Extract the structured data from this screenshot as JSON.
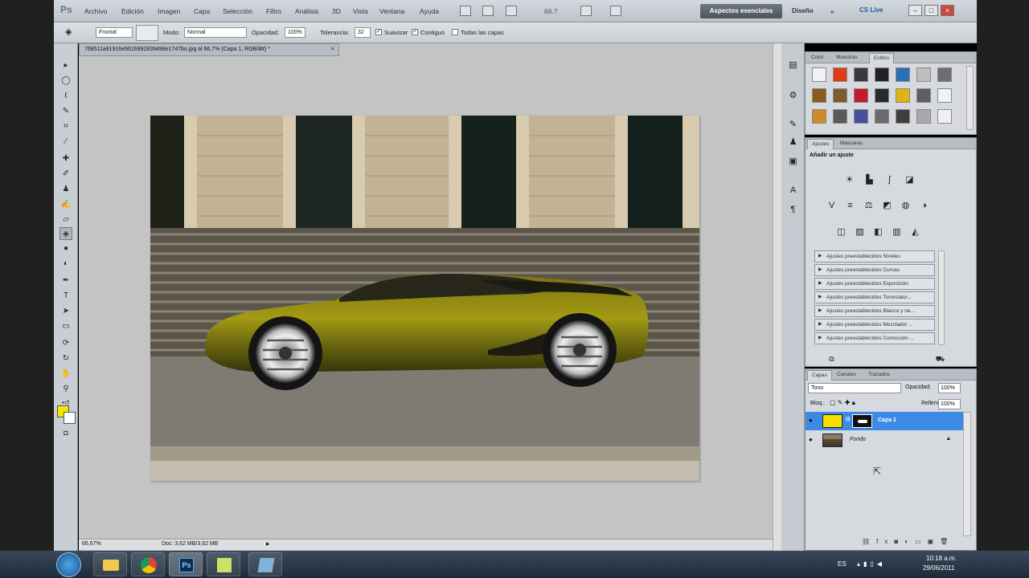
{
  "app": {
    "logo": "Ps"
  },
  "menu": [
    "Archivo",
    "Edición",
    "Imagen",
    "Capa",
    "Selección",
    "Filtro",
    "Análisis",
    "3D",
    "Vista",
    "Ventana",
    "Ayuda"
  ],
  "zoom_menu": "66.7",
  "workspace": {
    "active": "Aspectos esenciales",
    "design": "Diseño",
    "cslive": "CS Live"
  },
  "options": {
    "sample": "Frontal",
    "mode_label": "Modo:",
    "mode_value": "Normal",
    "opacity_label": "Opacidad:",
    "opacity_value": "100%",
    "tolerance_label": "Tolerancia:",
    "tolerance_value": "32",
    "smooth": "Suavizar",
    "contiguous": "Contiguo",
    "all_layers": "Todas las capas"
  },
  "document": {
    "tab": "768511a91916e5616992839498e1747bo.jpg al 66,7% (Capa 1, RGB/8#) *"
  },
  "status": {
    "zoom": "66,67%",
    "doc": "Doc: 3,62 MB/3,62 MB"
  },
  "swatches_panel": {
    "tabs": [
      "Color",
      "Muestras",
      "Estilos"
    ],
    "styles": [
      "#f2f2f2",
      "#e03b14",
      "#3a3a3a",
      "#222",
      "#2b6fb5",
      "#bdbdbd",
      "#6e6e6e",
      "#8c5a1a",
      "#7d5b2e",
      "#c4182c",
      "#2a2a2a",
      "#e0b415",
      "#5e5e5e",
      "#f2f2f2",
      "#d08a2a",
      "#5a5a5a",
      "#4b4e9c",
      "#6a6a6a",
      "#3e3e3e",
      "#a9a9a9",
      "#f0f0f0"
    ]
  },
  "adjust_panel": {
    "tabs": [
      "Ajustes",
      "Máscaras"
    ],
    "title": "Añadir un ajuste",
    "presets": [
      "Ajustes preestablecidos Niveles",
      "Ajustes preestablecidos Curvas",
      "Ajustes preestablecidos Exposición",
      "Ajustes preestablecidos Tono/satur...",
      "Ajustes preestablecidos Blanco y ne...",
      "Ajustes preestablecidos Mezclador ...",
      "Ajustes preestablecidos Corrección ..."
    ]
  },
  "layers_panel": {
    "tabs": [
      "Capas",
      "Canales",
      "Trazados"
    ],
    "blend": "Tono",
    "opacity_label": "Opacidad:",
    "opacity_value": "100%",
    "lock_label": "Bloq.:",
    "fill_label": "Relleno:",
    "fill_value": "100%",
    "layers": [
      {
        "name": "Capa 1",
        "color": "#f7e000",
        "selected": true
      },
      {
        "name": "Fondo",
        "color": "#6b4a2f",
        "selected": false
      }
    ]
  },
  "taskbar": {
    "lang": "ES",
    "time": "10:18 a.m.",
    "date": "29/06/2011"
  },
  "colors": {
    "foreground": "#f2e600",
    "background": "#ffffff",
    "accent": "#3c8ae6"
  }
}
